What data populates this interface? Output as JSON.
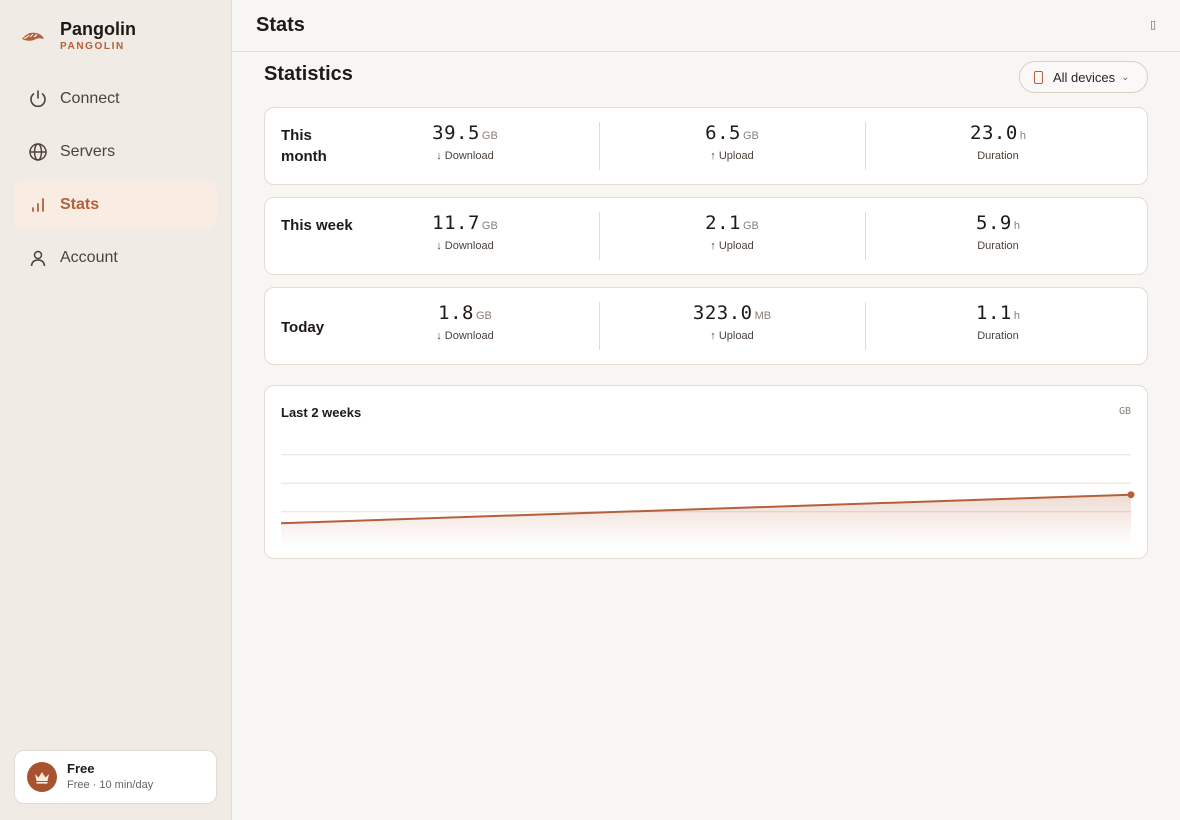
{
  "brand": {
    "name": "Pangolin",
    "sub": "PANGOLIN"
  },
  "nav": [
    {
      "label": "Connect",
      "icon": "power-icon",
      "active": false
    },
    {
      "label": "Servers",
      "icon": "globe-icon",
      "active": false
    },
    {
      "label": "Stats",
      "icon": "bar-chart-icon",
      "active": true
    },
    {
      "label": "Account",
      "icon": "user-icon",
      "active": false
    }
  ],
  "plan": {
    "title": "Free",
    "subtitle": "Free · 10 min/day",
    "icon": "crown-icon"
  },
  "topbar": {
    "title": "Stats",
    "glyph": "▯"
  },
  "main": {
    "title": "Statistics",
    "device_select": {
      "value": "All devices",
      "icon": "phone-icon"
    }
  },
  "stats": [
    {
      "label": "This month",
      "download": {
        "value": "39.5",
        "unit": "GB",
        "caption": "↓ Download"
      },
      "upload": {
        "value": "6.5",
        "unit": "GB",
        "caption": "↑ Upload"
      },
      "duration": {
        "value": "23.0",
        "unit": "h",
        "caption": "Duration"
      }
    },
    {
      "label": "This week",
      "download": {
        "value": "11.7",
        "unit": "GB",
        "caption": "↓ Download"
      },
      "upload": {
        "value": "2.1",
        "unit": "GB",
        "caption": "↑ Upload"
      },
      "duration": {
        "value": "5.9",
        "unit": "h",
        "caption": "Duration"
      }
    },
    {
      "label": "Today",
      "download": {
        "value": "1.8",
        "unit": "GB",
        "caption": "↓ Download"
      },
      "upload": {
        "value": "323.0",
        "unit": "MB",
        "caption": "↑ Upload"
      },
      "duration": {
        "value": "1.1",
        "unit": "h",
        "caption": "Duration"
      }
    }
  ],
  "chart": {
    "title": "Last 2 weeks",
    "unit": "GB"
  },
  "chart_data": {
    "type": "area",
    "title": "Last 2 weeks",
    "ylabel": "GB",
    "x": [
      0,
      1
    ],
    "values": [
      0.2,
      0.45
    ],
    "ylim": [
      0,
      1
    ],
    "grid": true,
    "accent": "#b4603a"
  },
  "colors": {
    "accent": "#b4603a",
    "sidebar_bg": "#f1ebe5",
    "page_bg": "#f8f6f3"
  }
}
